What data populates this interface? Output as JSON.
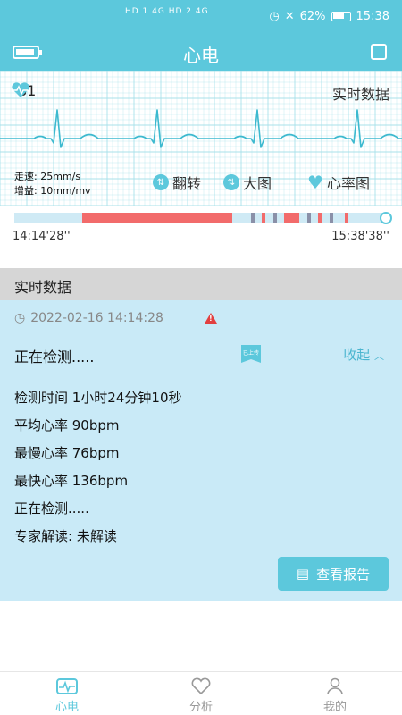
{
  "status_bar": {
    "signal": "HD 1 4G  HD 2 4G",
    "battery_percent": "62%",
    "time": "15:38"
  },
  "header": {
    "title": "心电",
    "icons": {
      "left": "device-battery-icon",
      "right": "calendar-icon"
    }
  },
  "ecg": {
    "heart_rate": "81",
    "realtime_label": "实时数据",
    "speed": "走速: 25mm/s",
    "gain": "增益: 10mm/mv",
    "flip_label": "翻转",
    "zoom_label": "大图",
    "hr_chart_label": "心率图",
    "grid_color": "#a8e1ea",
    "trace_color": "#3cb9cf"
  },
  "timeline": {
    "start_time": "14:14'28''",
    "end_time": "15:38'38''",
    "colors": {
      "normal": "#cfeaf5",
      "alert": "#f26b6b",
      "mark": "#8a90a8"
    }
  },
  "section_title": "实时数据",
  "record": {
    "datetime": "2022-02-16 14:14:28",
    "status_title": "正在检测.....",
    "uploaded_badge": "已上传",
    "collapse_label": "收起",
    "details": [
      "检测时间 1小时24分钟10秒",
      "平均心率 90bpm",
      "最慢心率 76bpm",
      "最快心率 136bpm",
      "正在检测.....",
      "专家解读:  未解读"
    ],
    "report_button": "查看报告"
  },
  "bottom_nav": [
    {
      "label": "心电",
      "icon": "ecg-icon",
      "active": true
    },
    {
      "label": "分析",
      "icon": "heart-outline-icon",
      "active": false
    },
    {
      "label": "我的",
      "icon": "user-icon",
      "active": false
    }
  ]
}
